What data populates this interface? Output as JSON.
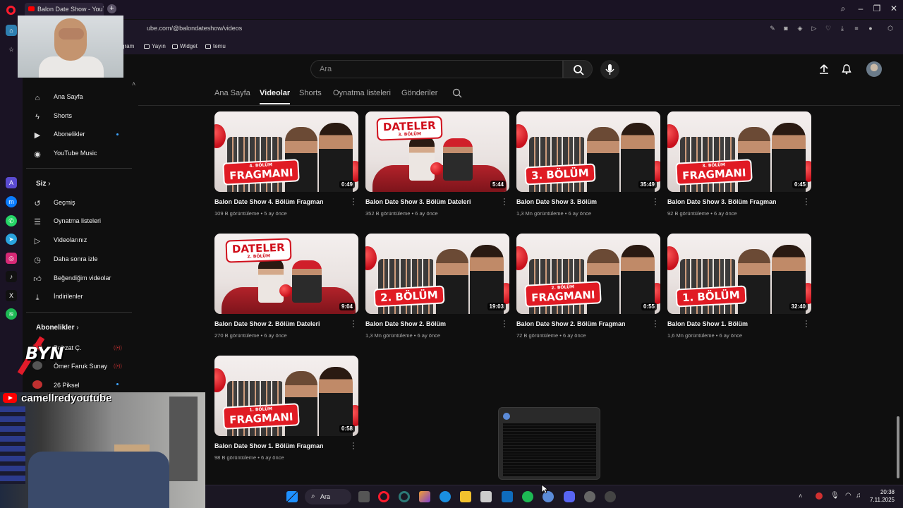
{
  "browser": {
    "tab_title": "Balon Date Show - YouTube",
    "new_tab": "+",
    "url": "ube.com/@balondateshow/videos",
    "bookmarks": [
      "gram",
      "Yayın",
      "Widget",
      "temu"
    ]
  },
  "youtube": {
    "search_placeholder": "Ara",
    "channel_tabs": [
      "Ana Sayfa",
      "Videolar",
      "Shorts",
      "Oynatma listeleri",
      "Gönderiler"
    ],
    "active_tab": "Videolar",
    "sidebar": {
      "main": [
        {
          "label": "Ana Sayfa",
          "icon": "home-icon"
        },
        {
          "label": "Shorts",
          "icon": "shorts-icon"
        },
        {
          "label": "Abonelikler",
          "icon": "subscriptions-icon"
        },
        {
          "label": "YouTube Music",
          "icon": "music-icon"
        }
      ],
      "you_heading": "Siz",
      "you": [
        {
          "label": "Geçmiş",
          "icon": "history-icon"
        },
        {
          "label": "Oynatma listeleri",
          "icon": "playlists-icon"
        },
        {
          "label": "Videolarınız",
          "icon": "your-videos-icon"
        },
        {
          "label": "Daha sonra izle",
          "icon": "watch-later-icon"
        },
        {
          "label": "Beğendiğim videolar",
          "icon": "liked-icon"
        },
        {
          "label": "İndirilenler",
          "icon": "downloads-icon"
        }
      ],
      "subs_heading": "Abonelikler",
      "subs": [
        "Behzat Ç.",
        "Ömer Faruk Sunay",
        "26 Piksel"
      ]
    },
    "videos": [
      {
        "title": "Balon Date Show 4. Bölüm Fragman",
        "views": "109 B görüntüleme",
        "age": "5 ay önce",
        "duration": "0:49",
        "banner": "FRAGMANI",
        "banner_sub": "4. BÖLÜM",
        "style": "group"
      },
      {
        "title": "Balon Date Show 3. Bölüm Dateleri",
        "views": "352 B görüntüleme",
        "age": "6 ay önce",
        "duration": "5:44",
        "banner": "DATELER",
        "banner_sub": "3. BÖLÜM",
        "style": "date"
      },
      {
        "title": "Balon Date Show 3. Bölüm",
        "views": "1,3 Mn görüntüleme",
        "age": "6 ay önce",
        "duration": "35:49",
        "banner": "3. BÖLÜM",
        "banner_sub": "",
        "style": "group"
      },
      {
        "title": "Balon Date Show 3. Bölüm Fragman",
        "views": "92 B görüntüleme",
        "age": "6 ay önce",
        "duration": "0:45",
        "banner": "FRAGMANI",
        "banner_sub": "3. BÖLÜM",
        "style": "group"
      },
      {
        "title": "Balon Date Show 2. Bölüm Dateleri",
        "views": "270 B görüntüleme",
        "age": "6 ay önce",
        "duration": "9:04",
        "banner": "DATELER",
        "banner_sub": "2. BÖLÜM",
        "style": "date"
      },
      {
        "title": "Balon Date Show 2. Bölüm",
        "views": "1,3 Mn görüntüleme",
        "age": "6 ay önce",
        "duration": "19:03",
        "banner": "2. BÖLÜM",
        "banner_sub": "",
        "style": "group"
      },
      {
        "title": "Balon Date Show 2. Bölüm Fragman",
        "views": "72 B görüntüleme",
        "age": "6 ay önce",
        "duration": "0:55",
        "banner": "FRAGMANI",
        "banner_sub": "2. BÖLÜM",
        "style": "group"
      },
      {
        "title": "Balon Date Show 1. Bölüm",
        "views": "1,6 Mn görüntüleme",
        "age": "6 ay önce",
        "duration": "32:40",
        "banner": "1. BÖLÜM",
        "banner_sub": "",
        "style": "group"
      },
      {
        "title": "Balon Date Show 1. Bölüm Fragman",
        "views": "98 B görüntüleme",
        "age": "6 ay önce",
        "duration": "0:58",
        "banner": "FRAGMANI",
        "banner_sub": "1. BÖLÜM",
        "style": "group"
      }
    ]
  },
  "overlay": {
    "channel_name": "camellredyoutube",
    "logo_text": "BYN"
  },
  "taskbar": {
    "search_label": "Ara",
    "time": "20:38",
    "date": "7.11.2025"
  }
}
